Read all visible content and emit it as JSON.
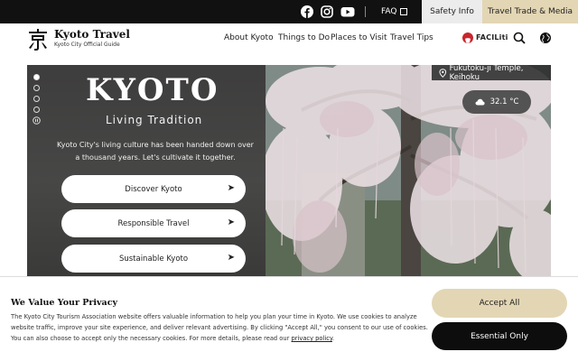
{
  "topbar": {
    "social": [
      "facebook-icon",
      "instagram-icon",
      "youtube-icon"
    ],
    "faq_label": "FAQ",
    "safety_label": "Safety Info",
    "trade_label": "Travel Trade & Media"
  },
  "brand": {
    "title": "Kyoto Travel",
    "subtitle": "Kyoto City Official Guide"
  },
  "nav": {
    "items": [
      "About Kyoto",
      "Things to Do",
      "Places to Visit",
      "Travel Tips"
    ],
    "facilities_label": "FACILiti"
  },
  "hero": {
    "title": "KYOTO",
    "subtitle": "Living Tradition",
    "description": "Kyoto City's living culture has been handed down over a thousand years. Let's cultivate it together.",
    "buttons": [
      "Discover Kyoto",
      "Responsible Travel",
      "Sustainable Kyoto"
    ],
    "location": "Fukutoku-ji Temple, Keihoku",
    "temperature": "32.1 °C",
    "slides_total": 5,
    "slide_active": 1
  },
  "cookie": {
    "title": "We Value Your Privacy",
    "text": "The Kyoto City Tourism Association website offers valuable information to help you plan your time in Kyoto. We use cookies to analyze website traffic, improve your site experience, and deliver relevant advertising. By clicking \"Accept All,\" you consent to our use of cookies. You can also choose to accept only the necessary cookies. For more details, please read our ",
    "link_label": "privacy policy",
    "text_end": ".",
    "accept_label": "Accept All",
    "essential_label": "Essential Only"
  },
  "colors": {
    "accent_gold": "#e3d6b4",
    "dark": "#111111",
    "facil_red": "#c8262c"
  }
}
